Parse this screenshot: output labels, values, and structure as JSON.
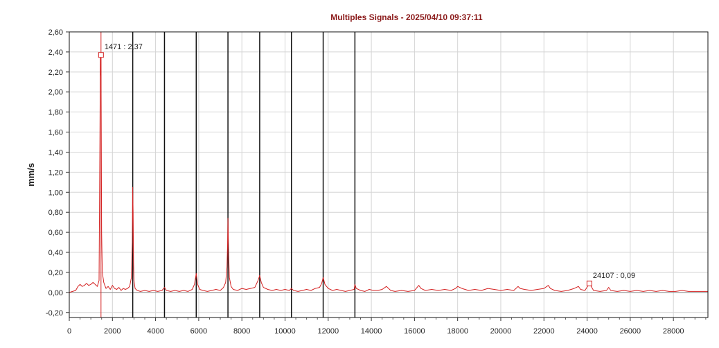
{
  "chart_data": {
    "type": "line",
    "title": "Multiples Signals - 2025/04/10 09:37:11",
    "xlabel": "",
    "ylabel": "mm/s",
    "xlim": [
      0,
      29600
    ],
    "ylim": [
      -0.25,
      2.6
    ],
    "x_ticks": [
      0,
      2000,
      4000,
      6000,
      8000,
      10000,
      12000,
      14000,
      16000,
      18000,
      20000,
      22000,
      24000,
      26000,
      28000
    ],
    "x_tick_labels": [
      "0",
      "2000",
      "4000",
      "6000",
      "8000",
      "10000",
      "12000",
      "14000",
      "16000",
      "18000",
      "20000",
      "22000",
      "24000",
      "26000",
      "28000"
    ],
    "y_ticks": [
      -0.2,
      0.0,
      0.2,
      0.4,
      0.6,
      0.8,
      1.0,
      1.2,
      1.4,
      1.6,
      1.8,
      2.0,
      2.2,
      2.4,
      2.6
    ],
    "y_tick_labels": [
      "-0,20",
      "0,00",
      "0,20",
      "0,40",
      "0,60",
      "0,80",
      "1,00",
      "1,20",
      "1,40",
      "1,60",
      "1,80",
      "2,00",
      "2,20",
      "2,40",
      "2,60"
    ],
    "grid": true,
    "colors": {
      "series": "#d42020",
      "title": "#8b1a1a",
      "harmonic_lines": "#111111",
      "grid": "#d4d4d4"
    },
    "harmonic_lines_x": [
      2942,
      4413,
      5884,
      7355,
      8826,
      10297,
      11768,
      13239
    ],
    "cursor_line_x": 1471,
    "markers": [
      {
        "x": 1471,
        "y": 2.37,
        "label": "1471 : 2,37"
      },
      {
        "x": 24107,
        "y": 0.09,
        "label": "24107 : 0,09"
      }
    ],
    "series": [
      {
        "x": [
          0,
          150,
          300,
          400,
          500,
          600,
          700,
          800,
          900,
          1000,
          1100,
          1200,
          1300,
          1380,
          1420,
          1440,
          1460,
          1471,
          1480,
          1500,
          1530,
          1600,
          1700,
          1800,
          1900,
          2000,
          2100,
          2200,
          2300,
          2400,
          2500,
          2600,
          2700,
          2800,
          2880,
          2920,
          2942,
          2960,
          2980,
          3000,
          3050,
          3150,
          3300,
          3500,
          3700,
          3900,
          4100,
          4300,
          4413,
          4500,
          4700,
          4900,
          5100,
          5300,
          5500,
          5700,
          5800,
          5884,
          5950,
          6050,
          6200,
          6400,
          6600,
          6800,
          7000,
          7150,
          7250,
          7310,
          7340,
          7355,
          7380,
          7420,
          7500,
          7600,
          7800,
          8000,
          8200,
          8400,
          8600,
          8750,
          8826,
          8900,
          9000,
          9200,
          9400,
          9600,
          9800,
          10000,
          10200,
          10297,
          10400,
          10600,
          10800,
          11000,
          11200,
          11400,
          11600,
          11700,
          11768,
          11850,
          12000,
          12200,
          12400,
          12600,
          12800,
          13000,
          13200,
          13239,
          13300,
          13500,
          13700,
          13900,
          14100,
          14300,
          14500,
          14700,
          14800,
          14900,
          15100,
          15400,
          15700,
          16000,
          16200,
          16300,
          16500,
          16800,
          17100,
          17400,
          17700,
          17900,
          18000,
          18200,
          18500,
          18800,
          19100,
          19400,
          19700,
          20000,
          20300,
          20600,
          20800,
          20900,
          21100,
          21400,
          21700,
          22000,
          22200,
          22300,
          22500,
          22800,
          23100,
          23400,
          23600,
          23700,
          23900,
          24107,
          24300,
          24600,
          24900,
          25000,
          25100,
          25400,
          25700,
          26000,
          26300,
          26600,
          26900,
          27200,
          27500,
          27800,
          28100,
          28400,
          28700,
          29000,
          29300,
          29600
        ],
        "values": [
          0.0,
          0.01,
          0.02,
          0.06,
          0.08,
          0.06,
          0.07,
          0.09,
          0.07,
          0.08,
          0.1,
          0.08,
          0.06,
          0.12,
          1.5,
          2.37,
          2.17,
          2.37,
          1.8,
          0.6,
          0.2,
          0.1,
          0.04,
          0.06,
          0.03,
          0.07,
          0.04,
          0.03,
          0.05,
          0.02,
          0.04,
          0.03,
          0.04,
          0.06,
          0.15,
          0.5,
          1.05,
          0.8,
          0.3,
          0.12,
          0.04,
          0.02,
          0.01,
          0.02,
          0.01,
          0.02,
          0.01,
          0.02,
          0.05,
          0.02,
          0.01,
          0.02,
          0.01,
          0.02,
          0.01,
          0.03,
          0.08,
          0.19,
          0.08,
          0.03,
          0.02,
          0.01,
          0.02,
          0.03,
          0.02,
          0.05,
          0.1,
          0.25,
          0.5,
          0.74,
          0.45,
          0.15,
          0.06,
          0.03,
          0.02,
          0.04,
          0.03,
          0.04,
          0.05,
          0.12,
          0.17,
          0.1,
          0.05,
          0.03,
          0.02,
          0.03,
          0.02,
          0.03,
          0.02,
          0.04,
          0.02,
          0.01,
          0.02,
          0.03,
          0.02,
          0.04,
          0.05,
          0.09,
          0.15,
          0.08,
          0.04,
          0.02,
          0.03,
          0.02,
          0.01,
          0.02,
          0.03,
          0.08,
          0.04,
          0.02,
          0.01,
          0.03,
          0.02,
          0.02,
          0.03,
          0.06,
          0.04,
          0.02,
          0.01,
          0.02,
          0.01,
          0.02,
          0.07,
          0.04,
          0.02,
          0.03,
          0.02,
          0.03,
          0.02,
          0.04,
          0.06,
          0.04,
          0.02,
          0.03,
          0.02,
          0.04,
          0.03,
          0.02,
          0.03,
          0.02,
          0.06,
          0.04,
          0.03,
          0.02,
          0.03,
          0.04,
          0.07,
          0.04,
          0.02,
          0.01,
          0.02,
          0.04,
          0.06,
          0.03,
          0.02,
          0.09,
          0.02,
          0.01,
          0.02,
          0.05,
          0.02,
          0.01,
          0.02,
          0.01,
          0.02,
          0.01,
          0.02,
          0.01,
          0.02,
          0.01,
          0.01,
          0.02,
          0.01,
          0.01,
          0.01,
          0.01
        ]
      }
    ]
  }
}
